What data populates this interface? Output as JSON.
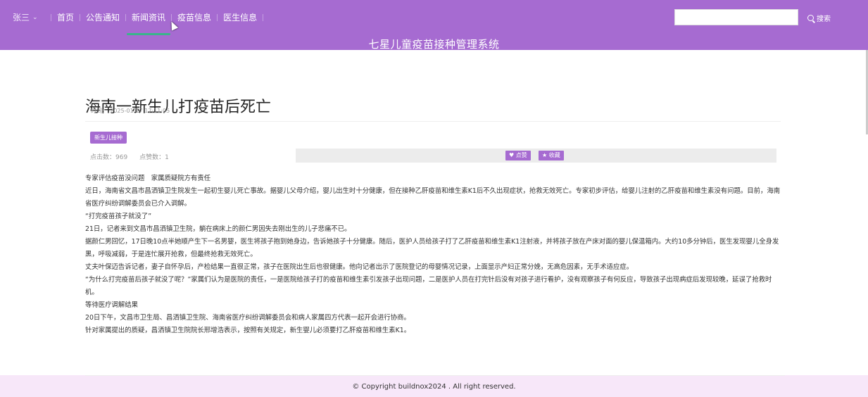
{
  "header": {
    "user": "张三",
    "nav": [
      "首页",
      "公告通知",
      "新闻资讯",
      "疫苗信息",
      "医生信息"
    ],
    "active_nav": "新闻资讯",
    "search_placeholder": "",
    "search_label": "搜索",
    "site_title": "七星儿童疫苗接种管理系统",
    "brand_color": "#a66bd1"
  },
  "article": {
    "title": "海南一新生儿打疫苗后死亡",
    "time_label": "时间:",
    "time": "2025-01-17 17:11:05",
    "tag": "新生儿接种",
    "clicks": "点击数：969",
    "likes": "点赞数：1",
    "like_button": "♥ 点赞",
    "favorite_button": "★ 收藏",
    "paragraphs": [
      "专家评估疫苗没问题　家属质疑院方有责任",
      "近日，海南省文昌市昌洒镇卫生院发生一起初生婴儿死亡事故。据婴儿父母介绍，婴儿出生时十分健康，但在接种乙肝疫苗和维生素K1后不久出现症状，抢救无效死亡。专家初步评估，给婴儿注射的乙肝疫苗和维生素没有问题。目前，海南省医疗纠纷调解委员会已介入调解。",
      "“打完疫苗孩子就没了”",
      "21日，记者来到文昌市昌洒镇卫生院，躺在病床上的颜仁男因失去刚出生的儿子悲痛不已。",
      "据颜仁男回忆，17日晚10点半她顺产生下一名男婴，医生将孩子抱到她身边，告诉她孩子十分健康。随后，医护人员给孩子打了乙肝疫苗和维生素K1注射液，并将孩子放在产床对面的婴儿保温箱内。大约10多分钟后，医生发现婴儿全身发黑，呼吸减弱，于是连忙展开抢救，但最终抢救无效死亡。",
      "丈夫叶保迈告诉记者，妻子自怀孕后，产检结果一直很正常，孩子在医院出生后也很健康。他向记者出示了医院登记的母婴情况记录，上面显示产妇正常分娩，无高危因素，无手术适应症。",
      "“为什么打完疫苗后孩子就没了呢？”家属们认为是医院的责任，一是医院给孩子打的疫苗和维生素引发孩子出现问题，二是医护人员在打完针后没有对孩子进行看护，没有观察孩子有何反应，导致孩子出现病症后发现较晚，延误了抢救时机。",
      "等待医疗调解结果",
      "20日下午，文昌市卫生局、昌洒镇卫生院、海南省医疗纠纷调解委员会和病人家属四方代表一起开会进行协商。",
      "针对家属提出的质疑，昌洒镇卫生院院长邢增浩表示，按照有关规定，新生婴儿必须要打乙肝疫苗和维生素K1。"
    ]
  },
  "footer": {
    "copyright": "© Copyright buildnox2024 . All right reserved."
  }
}
